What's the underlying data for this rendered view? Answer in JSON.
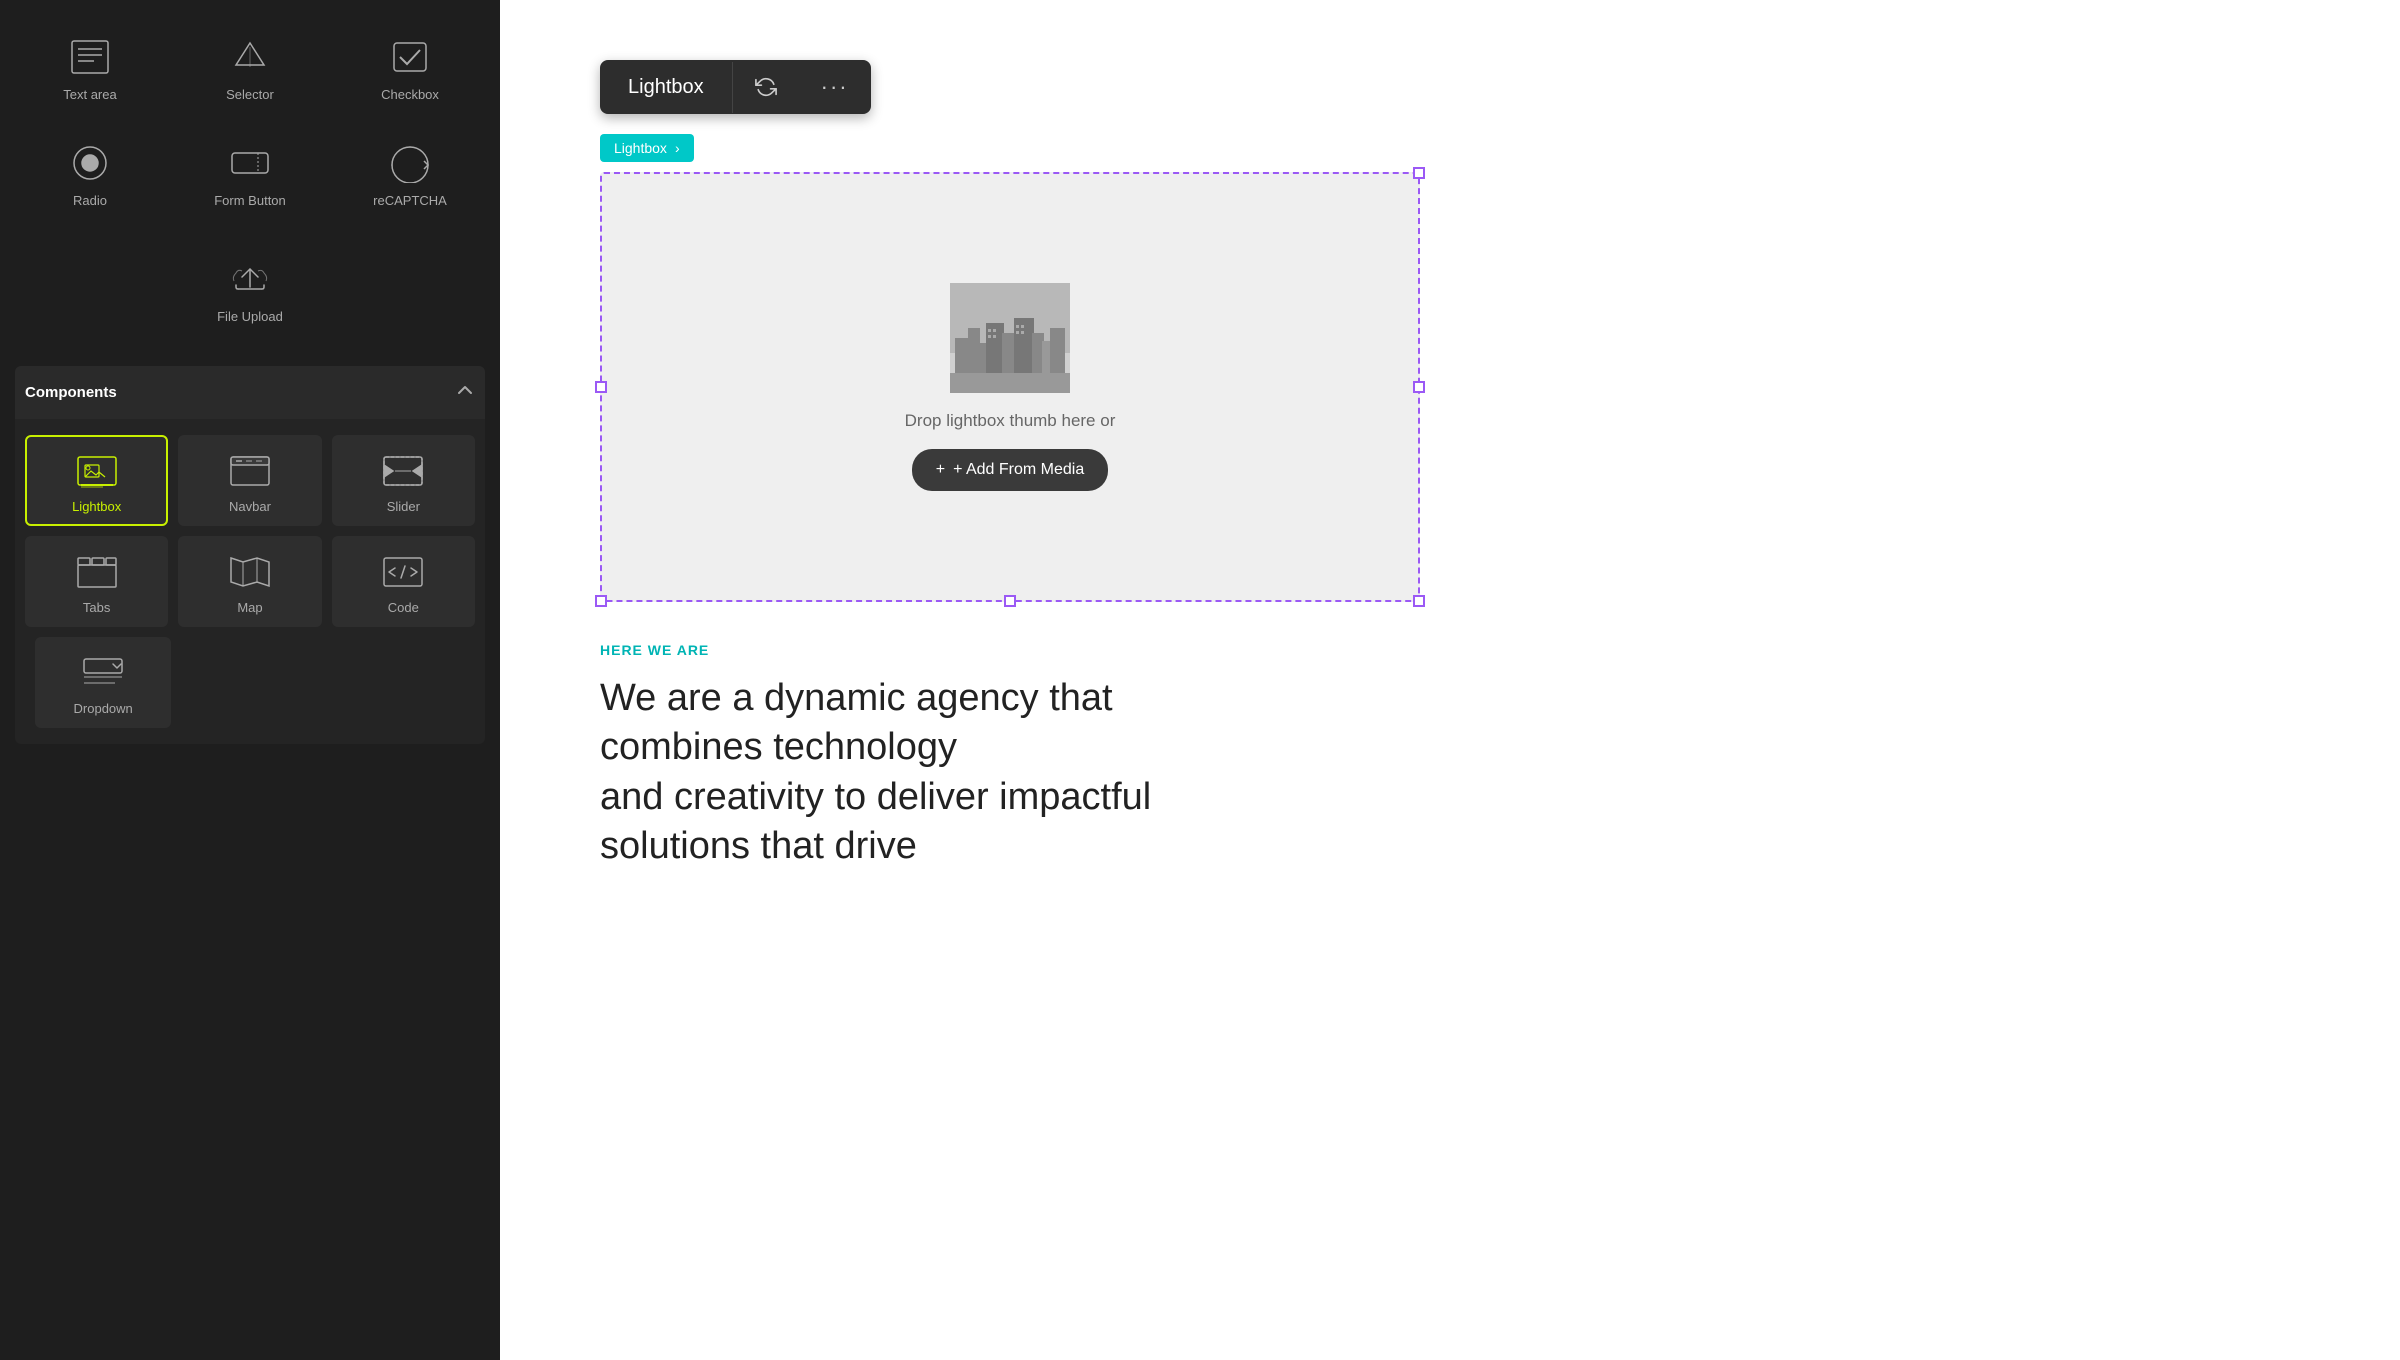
{
  "leftPanel": {
    "topItems": [
      {
        "id": "text-area",
        "label": "Text area"
      },
      {
        "id": "selector",
        "label": "Selector"
      },
      {
        "id": "checkbox",
        "label": "Checkbox"
      },
      {
        "id": "radio",
        "label": "Radio"
      },
      {
        "id": "form-button",
        "label": "Form Button"
      },
      {
        "id": "recaptcha",
        "label": "reCAPTCHA"
      },
      {
        "id": "file-upload",
        "label": "File Upload"
      }
    ],
    "components": {
      "title": "Components",
      "items": [
        {
          "id": "lightbox",
          "label": "Lightbox",
          "active": true
        },
        {
          "id": "navbar",
          "label": "Navbar",
          "active": false
        },
        {
          "id": "slider",
          "label": "Slider",
          "active": false
        },
        {
          "id": "tabs",
          "label": "Tabs",
          "active": false
        },
        {
          "id": "map",
          "label": "Map",
          "active": false
        },
        {
          "id": "code",
          "label": "Code",
          "active": false
        }
      ],
      "dropdown": {
        "id": "dropdown",
        "label": "Dropdown"
      }
    }
  },
  "toolbar": {
    "title": "Lightbox",
    "refresh_tooltip": "refresh",
    "more_tooltip": "more options",
    "more_dots": "···"
  },
  "breadcrumb": {
    "label": "Lightbox",
    "arrow": "›"
  },
  "lightbox": {
    "drop_text": "Drop lightbox thumb here or",
    "add_btn_label": "+ Add From Media"
  },
  "content": {
    "tag": "HERE WE ARE",
    "heading_line1": "We are a dynamic agency that combines technology",
    "heading_line2": "and creativity to deliver impactful solutions that drive"
  }
}
